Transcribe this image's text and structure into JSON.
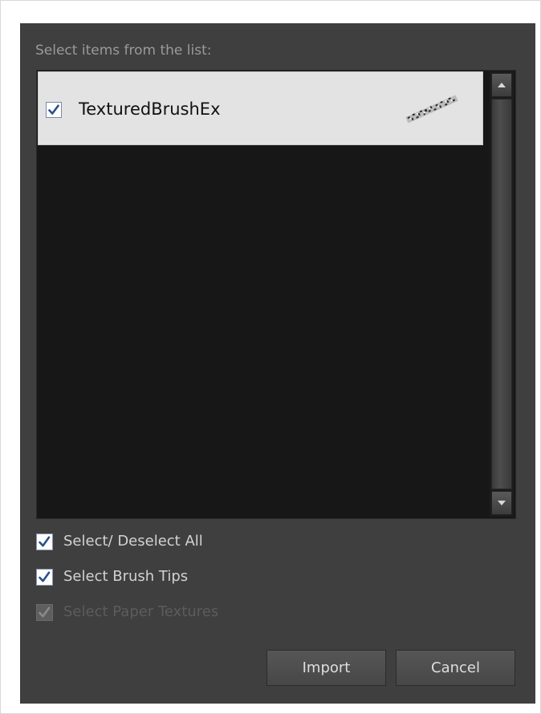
{
  "dialog": {
    "prompt": "Select items from the list:",
    "list": {
      "items": [
        {
          "label": "TexturedBrushEx",
          "checked": true,
          "preview_icon": "textured-brush-stroke"
        }
      ]
    },
    "options": [
      {
        "label": "Select/ Deselect All",
        "checked": true,
        "enabled": true
      },
      {
        "label": "Select Brush Tips",
        "checked": true,
        "enabled": true
      },
      {
        "label": "Select Paper Textures",
        "checked": true,
        "enabled": false
      }
    ],
    "buttons": {
      "import": "Import",
      "cancel": "Cancel"
    },
    "colors": {
      "panel": "#3f3f3f",
      "list_bg": "#171717",
      "row_bg": "#e3e3e3",
      "check_mark": "#2e4f8f"
    }
  }
}
